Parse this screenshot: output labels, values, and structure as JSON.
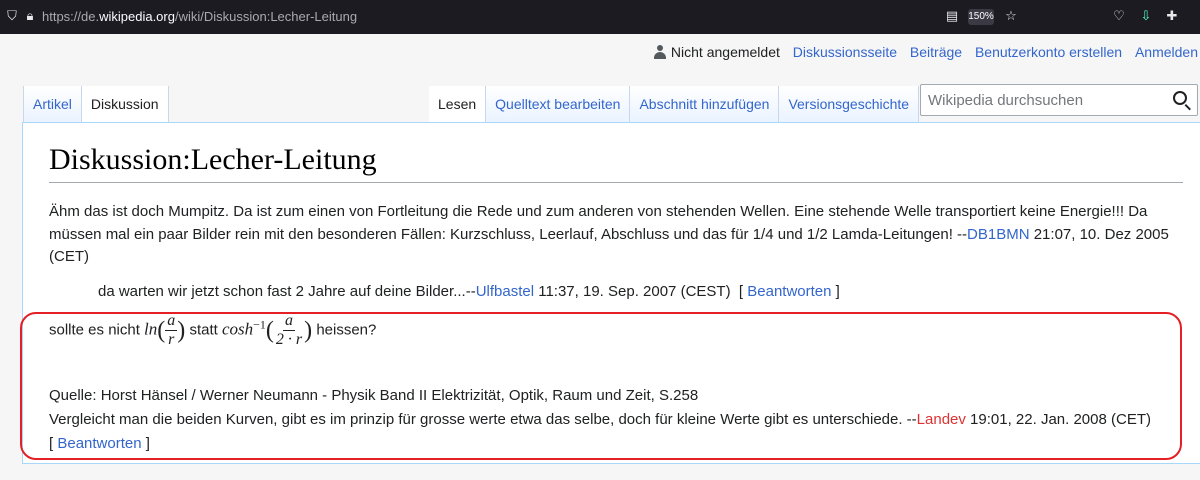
{
  "browser": {
    "url_prefix": "https://de.",
    "url_domain": "wikipedia.org",
    "url_path": "/wiki/Diskussion:Lecher-Leitung",
    "zoom": "150%"
  },
  "personal": {
    "status": "Nicht angemeldet",
    "links": [
      "Diskussionsseite",
      "Beiträge",
      "Benutzerkonto erstellen",
      "Anmelden"
    ]
  },
  "tabs_left": [
    "Artikel",
    "Diskussion"
  ],
  "tabs_right": [
    "Lesen",
    "Quelltext bearbeiten",
    "Abschnitt hinzufügen",
    "Versionsgeschichte"
  ],
  "search": {
    "placeholder": "Wikipedia durchsuchen"
  },
  "page_title": "Diskussion:Lecher-Leitung",
  "comments": {
    "c1_text": "Ähm das ist doch Mumpitz. Da ist zum einen von Fortleitung die Rede und zum anderen von stehenden Wellen. Eine stehende Welle transportiert keine Energie!!! Da müssen mal ein paar Bilder rein mit den besonderen Fällen: Kurzschluss, Leerlauf, Abschluss und das für 1/4 und 1/2 Lamda-Leitungen! --",
    "c1_user": "DB1BMN",
    "c1_time": " 21:07, 10. Dez 2005 (CET)",
    "c2_text": "da warten wir jetzt schon fast 2 Jahre auf deine Bilder...--",
    "c2_user": "Ulfbastel",
    "c2_time": " 11:37, 19. Sep. 2007 (CEST)",
    "reply_label": "Beantworten",
    "c3_pre": "sollte es nicht ",
    "c3_ln": "ln",
    "c3_frac1_num": "a",
    "c3_frac1_den": "r",
    "c3_mid": " statt ",
    "c3_cosh": "cosh",
    "c3_exp": "−1",
    "c3_frac2_num": "a",
    "c3_frac2_den": "2 · r",
    "c3_post": " heissen?",
    "c3_source": "Quelle: Horst Hänsel / Werner Neumann - Physik Band II Elektrizität, Optik, Raum und Zeit, S.258",
    "c3_text": "Vergleicht man die beiden Kurven, gibt es im prinzip für grosse werte etwa das selbe, doch für kleine Werte gibt es unterschiede. --",
    "c3_user": "Landev",
    "c3_time": " 19:01, 22. Jan. 2008 (CET)"
  }
}
